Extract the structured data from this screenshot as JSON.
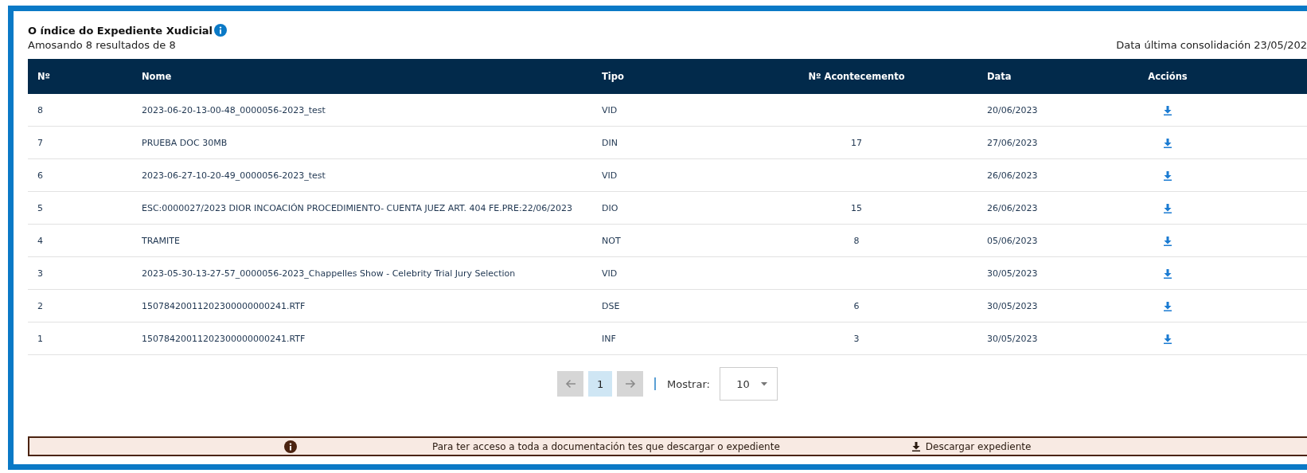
{
  "title": "O índice do Expediente Xudicial",
  "results": "Amosando 8 resultados de 8",
  "consolidation": "Data última consolidación 23/05/202",
  "table": {
    "columns": [
      "Nº",
      "Nome",
      "Tipo",
      "Nº Acontecemento",
      "Data",
      "Accións"
    ],
    "rows": [
      {
        "n": "8",
        "name": "2023-06-20-13-00-48_0000056-2023_test",
        "type": "VID",
        "event": "",
        "date": "20/06/2023"
      },
      {
        "n": "7",
        "name": "PRUEBA DOC 30MB",
        "type": "DIN",
        "event": "17",
        "date": "27/06/2023"
      },
      {
        "n": "6",
        "name": "2023-06-27-10-20-49_0000056-2023_test",
        "type": "VID",
        "event": "",
        "date": "26/06/2023"
      },
      {
        "n": "5",
        "name": "ESC:0000027/2023 DIOR INCOACIÓN PROCEDIMIENTO- CUENTA JUEZ ART. 404 FE.PRE:22/06/2023",
        "type": "DIO",
        "event": "15",
        "date": "26/06/2023"
      },
      {
        "n": "4",
        "name": "TRAMITE",
        "type": "NOT",
        "event": "8",
        "date": "05/06/2023"
      },
      {
        "n": "3",
        "name": "2023-05-30-13-27-57_0000056-2023_Chappelles Show - Celebrity Trial Jury Selection",
        "type": "VID",
        "event": "",
        "date": "30/05/2023"
      },
      {
        "n": "2",
        "name": "15078420011202300000000241.RTF",
        "type": "DSE",
        "event": "6",
        "date": "30/05/2023"
      },
      {
        "n": "1",
        "name": "15078420011202300000000241.RTF",
        "type": "INF",
        "event": "3",
        "date": "30/05/2023"
      }
    ]
  },
  "pagination": {
    "prev": {
      "disabled": true
    },
    "pages": [
      {
        "label": "1",
        "selected": true
      }
    ],
    "next": {
      "disabled": true
    },
    "show_label": "Mostrar:",
    "page_size": "10"
  },
  "notice": {
    "text": "Para ter acceso a toda a documentación tes que descargar o expediente",
    "link": "Descargar expediente"
  }
}
